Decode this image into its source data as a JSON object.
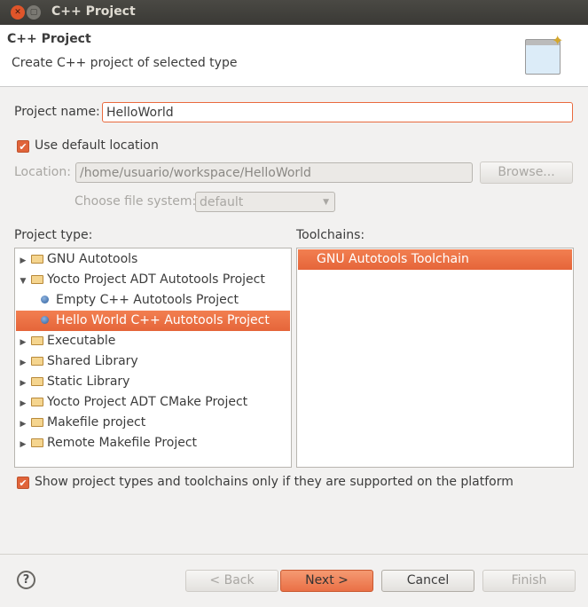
{
  "window": {
    "title": "C++ Project"
  },
  "header": {
    "title": "C++ Project",
    "subtitle": "Create C++ project of selected type"
  },
  "form": {
    "project_name_label": "Project name:",
    "project_name_value": "HelloWorld",
    "use_default_label": "Use default location",
    "location_label": "Location:",
    "location_value": "/home/usuario/workspace/HelloWorld",
    "browse_label": "Browse...",
    "filesystem_label": "Choose file system:",
    "filesystem_value": "default"
  },
  "project_type": {
    "label": "Project type:",
    "items": [
      {
        "label": "GNU Autotools",
        "kind": "folder",
        "expanded": false
      },
      {
        "label": "Yocto Project ADT Autotools Project",
        "kind": "folder",
        "expanded": true
      },
      {
        "label": "Empty C++ Autotools Project",
        "kind": "leaf"
      },
      {
        "label": "Hello World C++ Autotools Project",
        "kind": "leaf",
        "selected": true
      },
      {
        "label": "Executable",
        "kind": "folder",
        "expanded": false
      },
      {
        "label": "Shared Library",
        "kind": "folder",
        "expanded": false
      },
      {
        "label": "Static Library",
        "kind": "folder",
        "expanded": false
      },
      {
        "label": "Yocto Project ADT CMake Project",
        "kind": "folder",
        "expanded": false
      },
      {
        "label": "Makefile project",
        "kind": "folder",
        "expanded": false
      },
      {
        "label": "Remote Makefile Project",
        "kind": "folder",
        "expanded": false
      }
    ]
  },
  "toolchains": {
    "label": "Toolchains:",
    "items": [
      {
        "label": "GNU Autotools Toolchain",
        "selected": true
      }
    ]
  },
  "show_supported_label": "Show project types and toolchains only if they are supported on the platform",
  "buttons": {
    "back": "< Back",
    "next": "Next >",
    "cancel": "Cancel",
    "finish": "Finish",
    "help": "?"
  },
  "colors": {
    "accent": "#e96a3e",
    "titlebar": "#3c3b37"
  }
}
